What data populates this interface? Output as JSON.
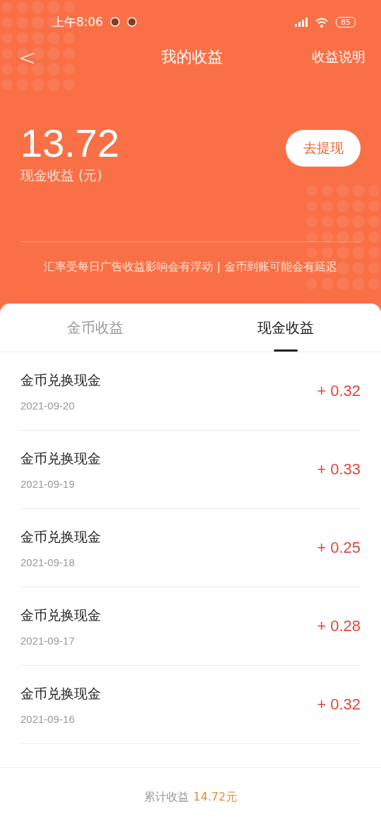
{
  "status_bar": {
    "time": "上午8:06",
    "battery": "85"
  },
  "nav": {
    "back": "<",
    "title": "我的收益",
    "action": "收益说明"
  },
  "balance": {
    "amount": "13.72",
    "label": "现金收益 (元)",
    "button": "去提现"
  },
  "notice": "汇率受每日广告收益影响会有浮动 | 金币到账可能会有延迟",
  "tabs": [
    {
      "label": "金币收益",
      "selected": false
    },
    {
      "label": "现金收益",
      "selected": true
    }
  ],
  "records": [
    {
      "title": "金币兑换现金",
      "date": "2021-09-20",
      "amount": "+ 0.32"
    },
    {
      "title": "金币兑换现金",
      "date": "2021-09-19",
      "amount": "+ 0.33"
    },
    {
      "title": "金币兑换现金",
      "date": "2021-09-18",
      "amount": "+ 0.25"
    },
    {
      "title": "金币兑换现金",
      "date": "2021-09-17",
      "amount": "+ 0.28"
    },
    {
      "title": "金币兑换现金",
      "date": "2021-09-16",
      "amount": "+ 0.32"
    }
  ],
  "footer": {
    "label": "累计收益",
    "value": "14.72元"
  }
}
